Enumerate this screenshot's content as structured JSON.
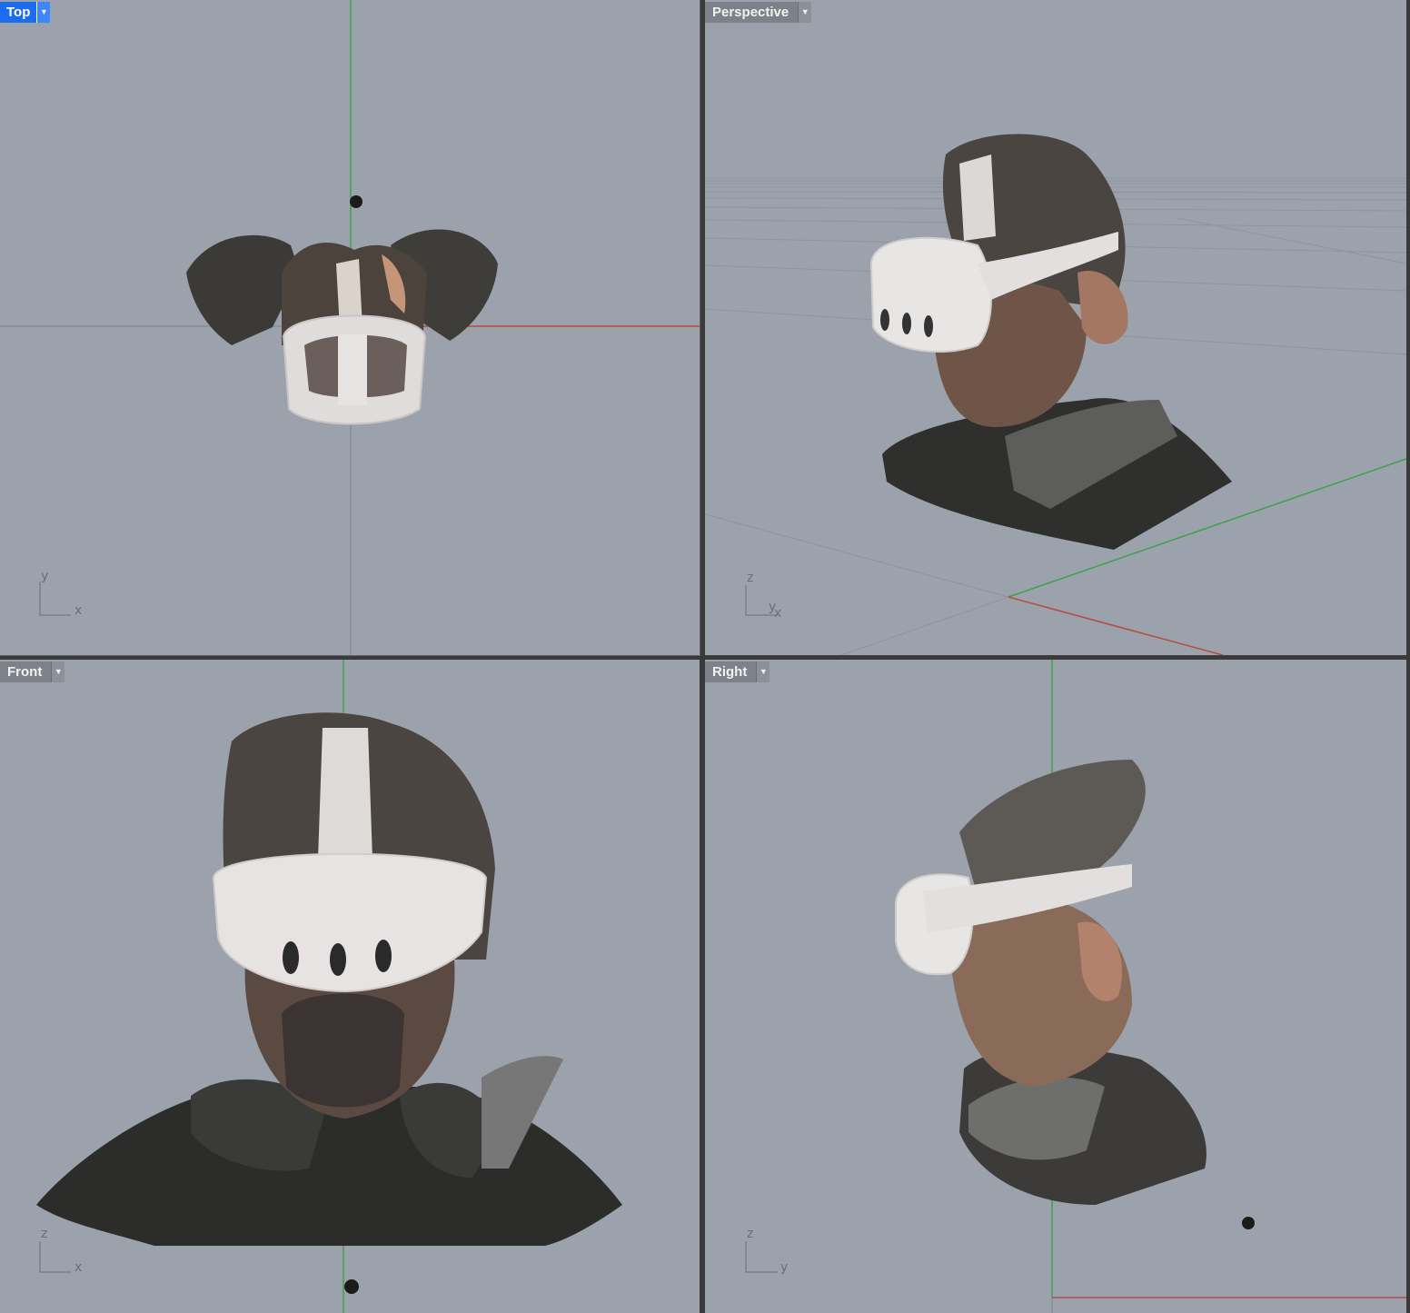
{
  "viewports": {
    "top": {
      "label": "Top",
      "axis_h": "x",
      "axis_v": "y",
      "active": true
    },
    "perspective": {
      "label": "Perspective",
      "axis_h": "x",
      "axis_mid": "y",
      "axis_v": "z",
      "active": false
    },
    "front": {
      "label": "Front",
      "axis_h": "x",
      "axis_v": "z",
      "active": false
    },
    "right": {
      "label": "Right",
      "axis_h": "y",
      "axis_v": "z",
      "active": false
    }
  },
  "icons": {
    "dropdown": "chevron-down-icon"
  },
  "colors": {
    "viewport_bg": "#9ba2ab",
    "active_tab": "#1c6cf0",
    "x_axis": "#b84a42",
    "y_axis": "#3fa04c",
    "grid": "#8e949c"
  }
}
